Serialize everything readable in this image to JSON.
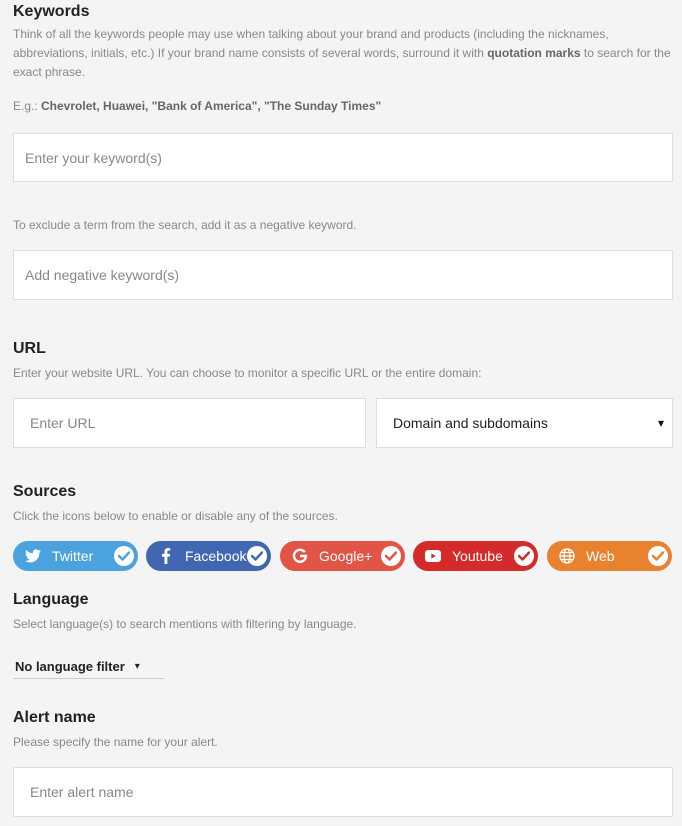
{
  "keywords": {
    "heading": "Keywords",
    "desc_part1": "Think of all the keywords people may use when talking about your brand and products (including the nicknames, abbreviations, initials, etc.) If your brand name consists of several words, surround it with ",
    "desc_bold": "quotation marks",
    "desc_part2": " to search for the exact phrase.",
    "example_prefix": "E.g.: ",
    "example_terms": "Chevrolet, Huawei, \"Bank of America\", \"The Sunday Times\"",
    "input_placeholder": "Enter your keyword(s)",
    "negative_desc": "To exclude a term from the search, add it as a negative keyword.",
    "negative_placeholder": "Add negative keyword(s)"
  },
  "url": {
    "heading": "URL",
    "desc": "Enter your website URL. You can choose to monitor a specific URL or the entire domain:",
    "input_placeholder": "Enter URL",
    "scope_selected": "Domain and subdomains",
    "scope_arrow": "▾"
  },
  "sources": {
    "heading": "Sources",
    "desc": "Click the icons below to enable or disable any of the sources.",
    "items": [
      {
        "label": "Twitter",
        "icon": "twitter-icon",
        "color": "#4aa3df",
        "check_color": "#4aa3df",
        "enabled": true
      },
      {
        "label": "Facebook",
        "icon": "facebook-icon",
        "color": "#4267b2",
        "check_color": "#4267b2",
        "enabled": true
      },
      {
        "label": "Google+",
        "icon": "google-icon",
        "color": "#e05545",
        "check_color": "#e05545",
        "enabled": true
      },
      {
        "label": "Youtube",
        "icon": "youtube-icon",
        "color": "#d42a2a",
        "check_color": "#d42a2a",
        "enabled": true
      },
      {
        "label": "Web",
        "icon": "globe-icon",
        "color": "#e8822f",
        "check_color": "#e8822f",
        "enabled": true
      }
    ]
  },
  "language": {
    "heading": "Language",
    "desc": "Select language(s) to search mentions with filtering by language.",
    "selected": "No language filter",
    "arrow": "▾"
  },
  "alert": {
    "heading": "Alert name",
    "desc": "Please specify the name for your alert.",
    "input_placeholder": "Enter alert name"
  }
}
